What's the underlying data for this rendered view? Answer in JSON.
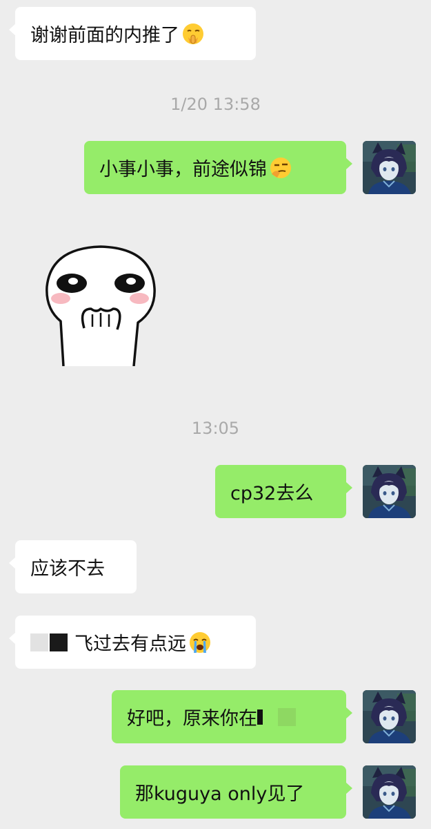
{
  "messages": {
    "m1": "谢谢前面的内推了",
    "t1": "1/20 13:58",
    "m2": "小事小事，前途似锦",
    "t2": "13:05",
    "m3": "cp32去么",
    "m4": "应该不去",
    "m5": "飞过去有点远",
    "m6": "好吧，原来你在",
    "m7": "那kuguya only见了"
  },
  "icons": {
    "m1_emoji": "shushing-face-emoji",
    "m2_emoji": "smirk-thinking-emoji",
    "m5_emoji": "loudly-crying-emoji",
    "sticker": "shy-white-character-sticker",
    "avatar": "anime-character-avatar"
  },
  "colors": {
    "background": "#ededed",
    "incoming_bubble": "#ffffff",
    "outgoing_bubble": "#95ec69",
    "timestamp": "#a9a9a9"
  }
}
